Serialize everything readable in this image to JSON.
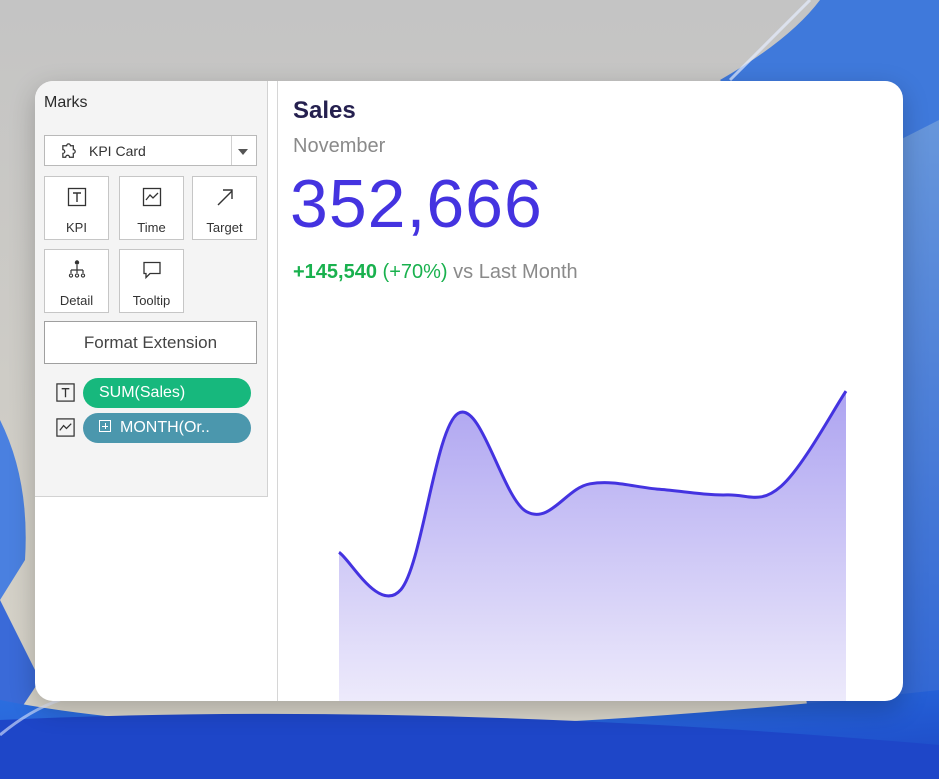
{
  "marks": {
    "title": "Marks",
    "mark_type": "KPI Card",
    "buttons": [
      {
        "label": "KPI",
        "icon": "text-icon"
      },
      {
        "label": "Time",
        "icon": "line-chart-icon"
      },
      {
        "label": "Target",
        "icon": "target-arrow-icon"
      },
      {
        "label": "Detail",
        "icon": "detail-icon"
      },
      {
        "label": "Tooltip",
        "icon": "tooltip-icon"
      }
    ],
    "format_button": "Format Extension",
    "fields": [
      {
        "label": "SUM(Sales)",
        "icon": "text-icon",
        "color": "#17b87d"
      },
      {
        "label": "MONTH(Or..",
        "icon": "line-chart-icon",
        "color": "#4b97ad"
      }
    ]
  },
  "kpi": {
    "title": "Sales",
    "period": "November",
    "value": "352,666",
    "change_value": "+145,540",
    "change_pct": "(+70%)",
    "comparison": "vs Last Month",
    "value_color": "#4433e0",
    "positive_color": "#19b14e"
  },
  "sparkline": {
    "type": "area",
    "line_color": "#4433e0",
    "fill_color": "#b4aaf0",
    "values": [
      207200,
      173500,
      332600,
      243800,
      269000,
      264000,
      259000,
      266800,
      352666
    ]
  }
}
